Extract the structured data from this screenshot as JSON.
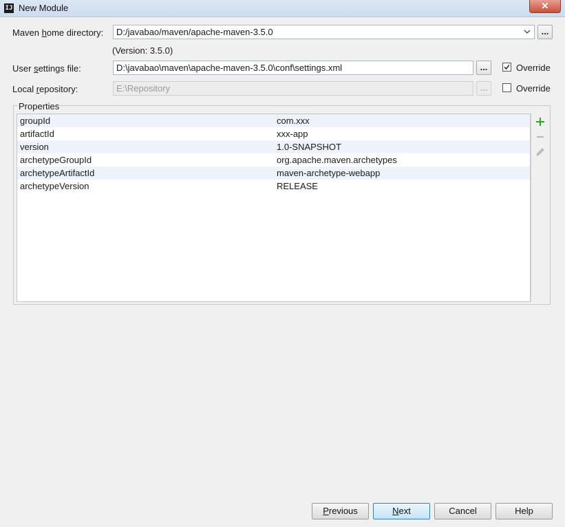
{
  "window": {
    "title": "New Module",
    "app_icon": "IJ",
    "close_glyph": "✕"
  },
  "maven_home": {
    "label_pre": "Maven ",
    "label_ul": "h",
    "label_post": "ome directory:",
    "value": "D:/javabao/maven/apache-maven-3.5.0",
    "version": "(Version: 3.5.0)",
    "browse": "..."
  },
  "user_settings": {
    "label_pre": "User ",
    "label_ul": "s",
    "label_post": "ettings file:",
    "value": "D:\\javabao\\maven\\apache-maven-3.5.0\\conf\\settings.xml",
    "browse": "...",
    "override_label": "Override",
    "override_checked": true
  },
  "local_repo": {
    "label_pre": "Local ",
    "label_ul": "r",
    "label_post": "epository:",
    "value": "E:\\Repository",
    "browse": "...",
    "override_label": "Override",
    "override_checked": false
  },
  "properties": {
    "title": "Properties",
    "rows": [
      {
        "key": "groupId",
        "value": "com.xxx"
      },
      {
        "key": "artifactId",
        "value": "xxx-app"
      },
      {
        "key": "version",
        "value": "1.0-SNAPSHOT"
      },
      {
        "key": "archetypeGroupId",
        "value": "org.apache.maven.archetypes"
      },
      {
        "key": "archetypeArtifactId",
        "value": "maven-archetype-webapp"
      },
      {
        "key": "archetypeVersion",
        "value": "RELEASE"
      }
    ],
    "tools": [
      "add-icon",
      "remove-icon",
      "edit-icon"
    ]
  },
  "buttons": {
    "previous_ul": "P",
    "previous_rest": "revious",
    "next_ul": "N",
    "next_rest": "ext",
    "cancel": "Cancel",
    "help": "Help"
  },
  "colors": {
    "add_icon": "#2e9d2e",
    "primary_border": "#3c7fb1"
  }
}
